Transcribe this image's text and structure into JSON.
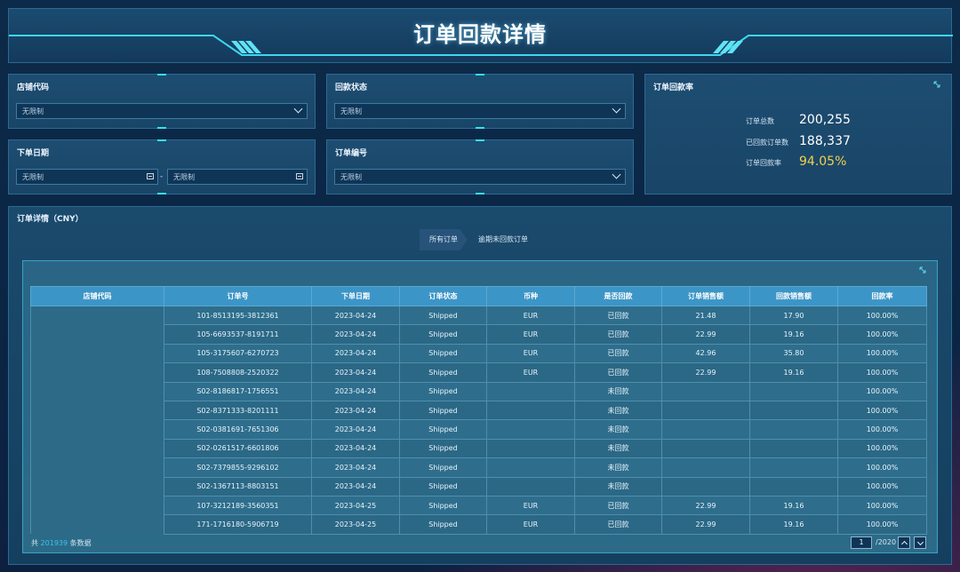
{
  "header": {
    "title": "订单回款详情"
  },
  "filters": {
    "store_code": {
      "label": "店铺代码",
      "value": "无限制"
    },
    "payment_status": {
      "label": "回款状态",
      "value": "无限制"
    },
    "order_date": {
      "label": "下单日期",
      "start": "无限制",
      "separator": "-",
      "end": "无限制"
    },
    "order_number": {
      "label": "订单编号",
      "value": "无限制"
    }
  },
  "summary": {
    "title": "订单回款率",
    "rows": [
      {
        "label": "订单总数",
        "value": "200,255"
      },
      {
        "label": "已回款订单数",
        "value": "188,337"
      },
      {
        "label": "订单回款率",
        "value": "94.05%"
      }
    ],
    "rate_color": "#f2d14b"
  },
  "detail": {
    "title": "订单详情（CNY）",
    "tabs": [
      "所有订单",
      "逾期未回款订单"
    ],
    "columns": [
      "店铺代码",
      "订单号",
      "下单日期",
      "订单状态",
      "币种",
      "是否回款",
      "订单销售额",
      "回款销售额",
      "回款率"
    ],
    "rows": [
      [
        "101-8513195-3812361",
        "2023-04-24",
        "Shipped",
        "EUR",
        "已回款",
        "21.48",
        "17.90",
        "100.00%"
      ],
      [
        "105-6693537-8191711",
        "2023-04-24",
        "Shipped",
        "EUR",
        "已回款",
        "22.99",
        "19.16",
        "100.00%"
      ],
      [
        "105-3175607-6270723",
        "2023-04-24",
        "Shipped",
        "EUR",
        "已回款",
        "42.96",
        "35.80",
        "100.00%"
      ],
      [
        "108-7508808-2520322",
        "2023-04-24",
        "Shipped",
        "EUR",
        "已回款",
        "22.99",
        "19.16",
        "100.00%"
      ],
      [
        "S02-8186817-1756551",
        "2023-04-24",
        "Shipped",
        "",
        "未回款",
        "",
        "",
        "100.00%"
      ],
      [
        "S02-8371333-8201111",
        "2023-04-24",
        "Shipped",
        "",
        "未回款",
        "",
        "",
        "100.00%"
      ],
      [
        "S02-0381691-7651306",
        "2023-04-24",
        "Shipped",
        "",
        "未回款",
        "",
        "",
        "100.00%"
      ],
      [
        "S02-0261517-6601806",
        "2023-04-24",
        "Shipped",
        "",
        "未回款",
        "",
        "",
        "100.00%"
      ],
      [
        "S02-7379855-9296102",
        "2023-04-24",
        "Shipped",
        "",
        "未回款",
        "",
        "",
        "100.00%"
      ],
      [
        "S02-1367113-8803151",
        "2023-04-24",
        "Shipped",
        "",
        "未回款",
        "",
        "",
        "100.00%"
      ],
      [
        "107-3212189-3560351",
        "2023-04-25",
        "Shipped",
        "EUR",
        "已回款",
        "22.99",
        "19.16",
        "100.00%"
      ],
      [
        "171-1716180-5906719",
        "2023-04-25",
        "Shipped",
        "EUR",
        "已回款",
        "22.99",
        "19.16",
        "100.00%"
      ]
    ],
    "footer": {
      "prefix": "共",
      "count": "201939",
      "suffix": "条数据"
    },
    "pager": {
      "current": "1",
      "total": "/2020"
    }
  }
}
